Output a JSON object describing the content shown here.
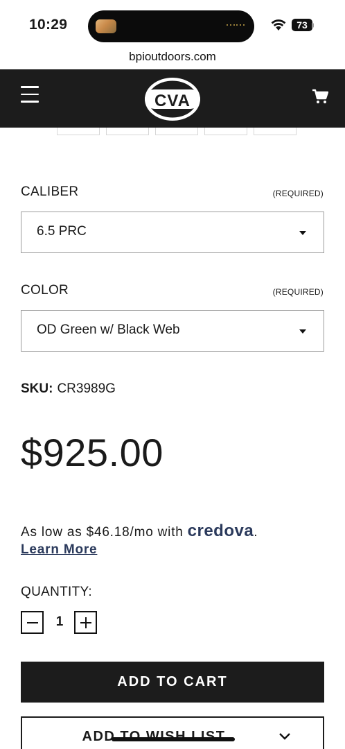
{
  "status_bar": {
    "time": "10:29",
    "battery": "73"
  },
  "browser": {
    "url": "bpioutdoors.com"
  },
  "header": {
    "logo_text": "CVA"
  },
  "options": [
    {
      "label": "CALIBER",
      "required": "(REQUIRED)",
      "value": "6.5 PRC"
    },
    {
      "label": "COLOR",
      "required": "(REQUIRED)",
      "value": "OD Green w/ Black Web"
    }
  ],
  "sku": {
    "label": "SKU:",
    "value": "CR3989G"
  },
  "price": "$925.00",
  "financing": {
    "text": "As low as $46.18/mo with",
    "brand": "credova",
    "suffix": ".",
    "link": "Learn More"
  },
  "quantity": {
    "label": "QUANTITY:",
    "value": "1"
  },
  "buttons": {
    "add_to_cart": "ADD TO CART",
    "add_to_wish_list": "ADD TO WISH LIST"
  },
  "colors": {
    "header_bg": "#1c1c1c",
    "credova_blue": "#2b3a5c"
  }
}
